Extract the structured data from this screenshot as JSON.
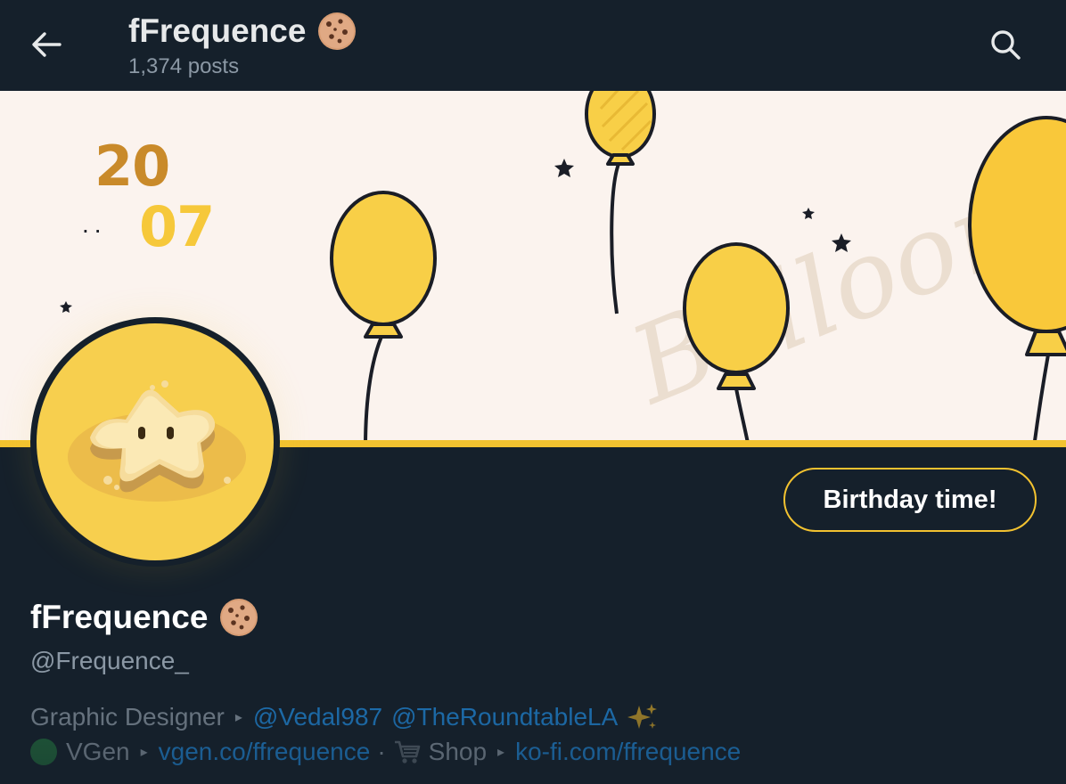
{
  "header": {
    "title": "fFrequence",
    "post_count": "1,374 posts"
  },
  "banner": {
    "date_top": "20",
    "date_bottom": "07",
    "date_dots": "..",
    "script_text": "Balloons"
  },
  "profile": {
    "display_name": "fFrequence",
    "handle": "@Frequence_",
    "action_button": "Birthday time!"
  },
  "bio": {
    "line1": {
      "role": "Graphic Designer",
      "mention1": "@Vedal987",
      "mention2": "@TheRoundtableLA"
    },
    "line2": {
      "vgen_label": "VGen",
      "vgen_link": "vgen.co/ffrequence",
      "separator": "·",
      "shop_label": "Shop",
      "shop_link": "ko-fi.com/ffrequence"
    }
  },
  "colors": {
    "background": "#15202b",
    "accent_gold": "#f2c230",
    "link_blue": "#1d6fb0",
    "muted_text": "#8b98a5"
  },
  "icons": [
    "back-arrow-icon",
    "search-icon",
    "cookie-emoji-icon",
    "sparkles-emoji-icon",
    "cart-icon",
    "vgen-icon",
    "arrow-right-icon"
  ]
}
